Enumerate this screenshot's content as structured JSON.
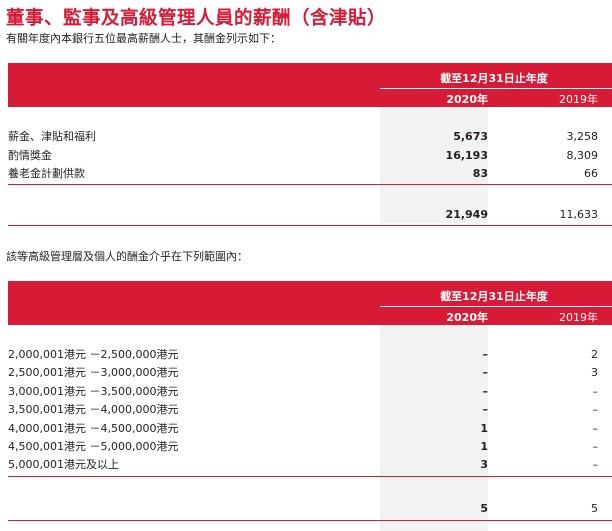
{
  "title": "董事、監事及高級管理人員的薪酬（含津貼）",
  "intro1": "有關年度內本銀行五位最高薪酬人士，其酬金列示如下：",
  "intro2": "該等高級管理層及個人的酬金介乎在下列範圍內：",
  "table1": {
    "period": "截至12月31日止年度",
    "year_current": "2020年",
    "year_prior": "2019年",
    "rows": [
      {
        "label": "薪金、津貼和福利",
        "v2020": "5,673",
        "v2019": "3,258"
      },
      {
        "label": "酌情獎金",
        "v2020": "16,193",
        "v2019": "8,309"
      },
      {
        "label": "養老金計劃供款",
        "v2020": "83",
        "v2019": "66"
      }
    ],
    "total": {
      "v2020": "21,949",
      "v2019": "11,633"
    }
  },
  "table2": {
    "period": "截至12月31日止年度",
    "year_current": "2020年",
    "year_prior": "2019年",
    "rows": [
      {
        "label": "2,000,001港元 －2,500,000港元",
        "v2020": "–",
        "v2019": "2"
      },
      {
        "label": "2,500,001港元 －3,000,000港元",
        "v2020": "–",
        "v2019": "3"
      },
      {
        "label": "3,000,001港元 －3,500,000港元",
        "v2020": "–",
        "v2019": "–"
      },
      {
        "label": "3,500,001港元 －4,000,000港元",
        "v2020": "–",
        "v2019": "–"
      },
      {
        "label": "4,000,001港元 －4,500,000港元",
        "v2020": "1",
        "v2019": "–"
      },
      {
        "label": "4,500,001港元 －5,000,000港元",
        "v2020": "1",
        "v2019": "–"
      },
      {
        "label": "5,000,001港元及以上",
        "v2020": "3",
        "v2019": "–"
      }
    ],
    "total": {
      "v2020": "5",
      "v2019": "5"
    }
  },
  "colors": {
    "accent": "#d71a36",
    "column_shade": "#f1f2f2"
  }
}
